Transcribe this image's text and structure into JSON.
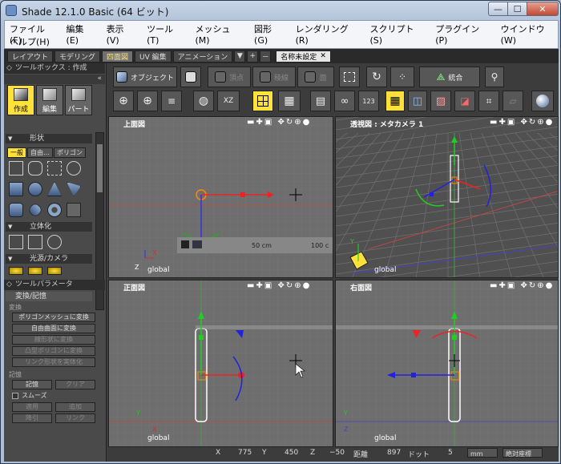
{
  "window": {
    "title": "Shade 12.1.0 Basic (64 ビット)",
    "min_glyph": "—",
    "max_glyph": "☐",
    "close_glyph": "✕"
  },
  "menu": {
    "row1": [
      "ファイル(F)",
      "編集(E)",
      "表示(V)",
      "ツール(T)",
      "メッシュ(M)",
      "図形(G)",
      "レンダリング(R)",
      "スクリプト(S)",
      "プラグイン(P)",
      "ウインドウ(W)"
    ],
    "row2": [
      "ヘルプ(H)"
    ]
  },
  "workspace_tabs": [
    {
      "label": "レイアウト",
      "active": false
    },
    {
      "label": "モデリング",
      "active": false
    },
    {
      "label": "四面図",
      "active": true
    },
    {
      "label": "UV 編集",
      "active": false
    },
    {
      "label": "アニメーション",
      "active": false
    }
  ],
  "tab_add_glyphs": [
    "▼",
    "+",
    "－"
  ],
  "document_tab": {
    "label": "名称未設定",
    "close": "✕"
  },
  "toolbox": {
    "header": "ツールボックス : 作成",
    "collapse_glyph": "«",
    "modes": [
      {
        "label": "作成",
        "active": true
      },
      {
        "label": "編集",
        "active": false
      },
      {
        "label": "パート",
        "active": false
      }
    ],
    "shape_section": "形状",
    "subtabs": [
      {
        "label": "一般",
        "active": true
      },
      {
        "label": "自由…",
        "active": false
      },
      {
        "label": "ポリゴン",
        "active": false
      }
    ],
    "solid_section": "立体化",
    "light_section": "光源/カメラ"
  },
  "param_panel": {
    "header": "ツールパラメータ",
    "section": "変換/記憶",
    "convert_label": "変換",
    "buttons": [
      {
        "label": "ポリゴンメッシュに変換",
        "enabled": true
      },
      {
        "label": "自由曲面に変換",
        "enabled": true
      },
      {
        "label": "線形状に変換",
        "enabled": false
      },
      {
        "label": "凸型ポリゴンに変換",
        "enabled": false
      },
      {
        "label": "リンク形状を実体化",
        "enabled": false
      }
    ],
    "memory_label": "記憶",
    "memory_buttons": [
      {
        "label": "記憶",
        "enabled": true
      },
      {
        "label": "クリア",
        "enabled": false
      }
    ],
    "smooth_label": "スムーズ",
    "apply_buttons": [
      {
        "label": "適用",
        "enabled": false
      },
      {
        "label": "追加",
        "enabled": false
      }
    ],
    "reset_buttons": [
      {
        "label": "降引",
        "enabled": false
      },
      {
        "label": "リンク",
        "enabled": false
      }
    ]
  },
  "toolbar": {
    "object_label": "オブジェクト",
    "vertex_label": "頂点",
    "edge_label": "稜線",
    "face_label": "面",
    "merge_label": "統合",
    "xz_label": "XZ",
    "num_label": "123"
  },
  "viewports": [
    {
      "title": "上面図",
      "global_label": "global",
      "ruler_label": "50 cm",
      "ruler_right": "100 c"
    },
    {
      "title": "透視図 : メタカメラ 1",
      "global_label": "global"
    },
    {
      "title": "正面図",
      "global_label": "global"
    },
    {
      "title": "右面図",
      "global_label": "global"
    }
  ],
  "viewport_controls": "▬✚▣  ✥↻⊕●",
  "status": {
    "x_label": "X",
    "x_value": "775",
    "y_label": "Y",
    "y_value": "450",
    "z_label": "Z",
    "z_value": "−50",
    "dist_label": "距離",
    "dist_value": "897",
    "dot_label": "ドット",
    "dot_value": "5",
    "unit": "mm",
    "coord_mode": "絶対座標"
  }
}
